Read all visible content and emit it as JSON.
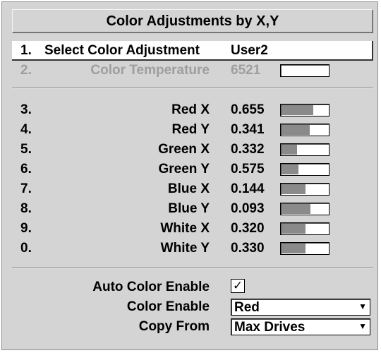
{
  "title": "Color Adjustments by X,Y",
  "select_row": {
    "num": "1.",
    "label": "Select Color Adjustment",
    "value": "User2"
  },
  "temp_row": {
    "num": "2.",
    "label": "Color Temperature",
    "value": "6521",
    "level": 0.0
  },
  "rows": [
    {
      "num": "3.",
      "label": "Red X",
      "value": "0.655",
      "level": 0.68
    },
    {
      "num": "4.",
      "label": "Red Y",
      "value": "0.341",
      "level": 0.6
    },
    {
      "num": "5.",
      "label": "Green X",
      "value": "0.332",
      "level": 0.33
    },
    {
      "num": "6.",
      "label": "Green Y",
      "value": "0.575",
      "level": 0.37
    },
    {
      "num": "7.",
      "label": "Blue X",
      "value": "0.144",
      "level": 0.52
    },
    {
      "num": "8.",
      "label": "Blue Y",
      "value": "0.093",
      "level": 0.62
    },
    {
      "num": "9.",
      "label": "White X",
      "value": "0.320",
      "level": 0.52
    },
    {
      "num": "0.",
      "label": "White Y",
      "value": "0.330",
      "level": 0.52
    }
  ],
  "auto_color_enable": {
    "label": "Auto Color Enable",
    "checked": true,
    "mark": "✓"
  },
  "color_enable": {
    "label": "Color Enable",
    "value": "Red",
    "arrow": "▼"
  },
  "copy_from": {
    "label": "Copy From",
    "value": "Max Drives",
    "arrow": "▼"
  },
  "icons": {
    "checkbox": "checkmark-icon",
    "dropdown": "dropdown-arrow-icon"
  },
  "colors": {
    "panel": "#d4d4d4",
    "bar_fill": "#8a8a8a",
    "dim_text": "#9e9e9e"
  }
}
